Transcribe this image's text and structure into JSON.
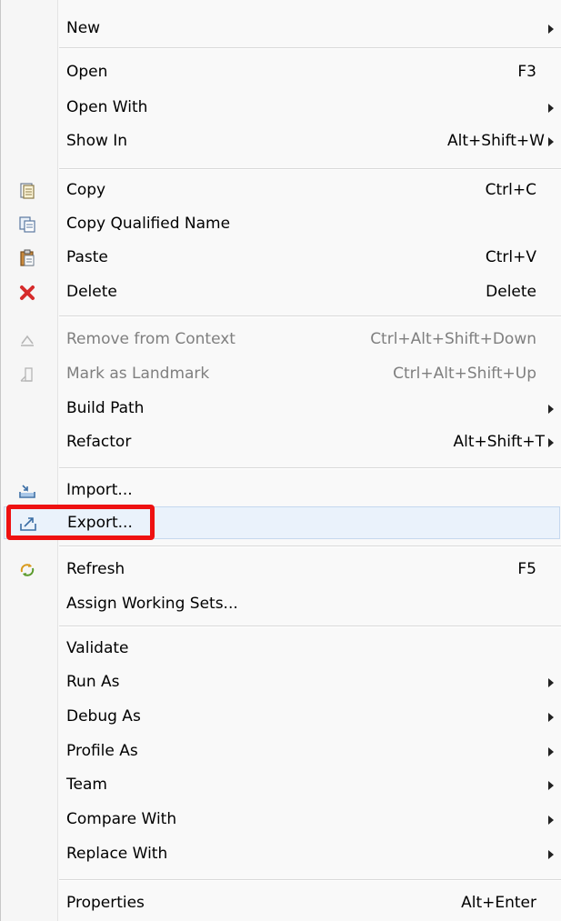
{
  "menu": {
    "items": [
      {
        "label": "New",
        "shortcut": "",
        "submenu": true,
        "icon": "",
        "disabled": false
      },
      {
        "label": "Open",
        "shortcut": "F3",
        "submenu": false,
        "icon": "",
        "disabled": false
      },
      {
        "label": "Open With",
        "shortcut": "",
        "submenu": true,
        "icon": "",
        "disabled": false
      },
      {
        "label": "Show In",
        "shortcut": "Alt+Shift+W",
        "submenu": true,
        "icon": "",
        "disabled": false
      },
      {
        "label": "Copy",
        "shortcut": "Ctrl+C",
        "submenu": false,
        "icon": "copy-icon",
        "disabled": false
      },
      {
        "label": "Copy Qualified Name",
        "shortcut": "",
        "submenu": false,
        "icon": "copy-qualified-name-icon",
        "disabled": false
      },
      {
        "label": "Paste",
        "shortcut": "Ctrl+V",
        "submenu": false,
        "icon": "paste-icon",
        "disabled": false
      },
      {
        "label": "Delete",
        "shortcut": "Delete",
        "submenu": false,
        "icon": "delete-icon",
        "disabled": false
      },
      {
        "label": "Remove from Context",
        "shortcut": "Ctrl+Alt+Shift+Down",
        "submenu": false,
        "icon": "remove-from-context-icon",
        "disabled": true
      },
      {
        "label": "Mark as Landmark",
        "shortcut": "Ctrl+Alt+Shift+Up",
        "submenu": false,
        "icon": "landmark-icon",
        "disabled": true
      },
      {
        "label": "Build Path",
        "shortcut": "",
        "submenu": true,
        "icon": "",
        "disabled": false
      },
      {
        "label": "Refactor",
        "shortcut": "Alt+Shift+T",
        "submenu": true,
        "icon": "",
        "disabled": false
      },
      {
        "label": "Import...",
        "shortcut": "",
        "submenu": false,
        "icon": "import-icon",
        "disabled": false
      },
      {
        "label": "Export...",
        "shortcut": "",
        "submenu": false,
        "icon": "export-icon",
        "disabled": false,
        "highlighted": true
      },
      {
        "label": "Refresh",
        "shortcut": "F5",
        "submenu": false,
        "icon": "refresh-icon",
        "disabled": false
      },
      {
        "label": "Assign Working Sets...",
        "shortcut": "",
        "submenu": false,
        "icon": "",
        "disabled": false
      },
      {
        "label": "Validate",
        "shortcut": "",
        "submenu": false,
        "icon": "",
        "disabled": false
      },
      {
        "label": "Run As",
        "shortcut": "",
        "submenu": true,
        "icon": "",
        "disabled": false
      },
      {
        "label": "Debug As",
        "shortcut": "",
        "submenu": true,
        "icon": "",
        "disabled": false
      },
      {
        "label": "Profile As",
        "shortcut": "",
        "submenu": true,
        "icon": "",
        "disabled": false
      },
      {
        "label": "Team",
        "shortcut": "",
        "submenu": true,
        "icon": "",
        "disabled": false
      },
      {
        "label": "Compare With",
        "shortcut": "",
        "submenu": true,
        "icon": "",
        "disabled": false
      },
      {
        "label": "Replace With",
        "shortcut": "",
        "submenu": true,
        "icon": "",
        "disabled": false
      },
      {
        "label": "Properties",
        "shortcut": "Alt+Enter",
        "submenu": false,
        "icon": "",
        "disabled": false
      }
    ]
  },
  "colors": {
    "highlight_background": "#eaf2fb",
    "callout_border": "#ee1111",
    "disabled_text": "#7f7f7f"
  }
}
